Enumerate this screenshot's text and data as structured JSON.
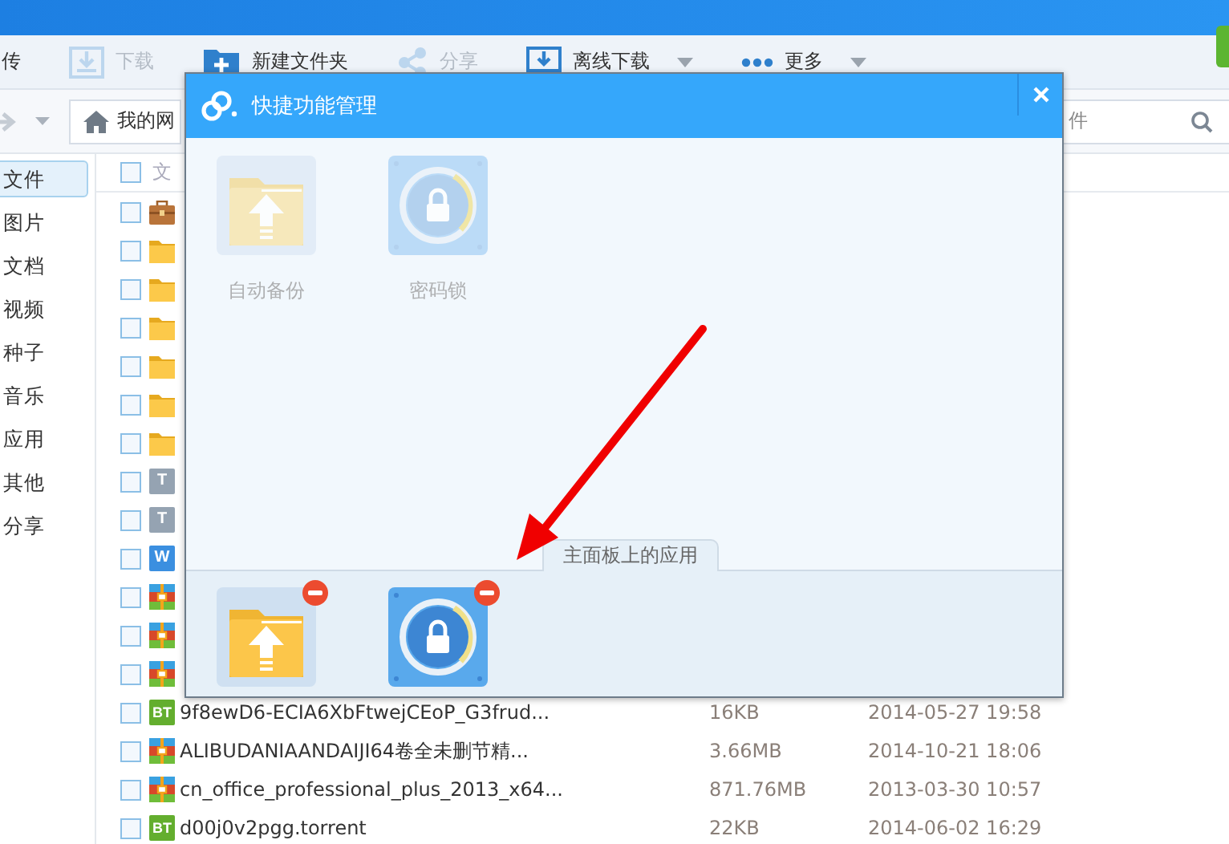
{
  "toolbar": {
    "items": [
      {
        "kind": "upload",
        "label": "传",
        "disabled": false,
        "has_menu": false
      },
      {
        "kind": "download",
        "label": "下载",
        "disabled": true,
        "has_menu": false
      },
      {
        "kind": "new-folder",
        "label": "新建文件夹",
        "disabled": false,
        "has_menu": false
      },
      {
        "kind": "share",
        "label": "分享",
        "disabled": true,
        "has_menu": false
      },
      {
        "kind": "offline",
        "label": "离线下载",
        "disabled": false,
        "has_menu": true
      },
      {
        "kind": "more",
        "label": "更多",
        "disabled": false,
        "has_menu": true
      }
    ]
  },
  "nav": {
    "location": "我的网",
    "search": {
      "placeholder": "件"
    }
  },
  "sidebar": {
    "items": [
      {
        "label": "文件",
        "selected": true
      },
      {
        "label": "图片",
        "selected": false
      },
      {
        "label": "文档",
        "selected": false
      },
      {
        "label": "视频",
        "selected": false
      },
      {
        "label": "种子",
        "selected": false
      },
      {
        "label": "音乐",
        "selected": false
      },
      {
        "label": "应用",
        "selected": false
      },
      {
        "label": "其他",
        "selected": false
      },
      {
        "label": "分享",
        "selected": false
      }
    ]
  },
  "file_list": {
    "header": {
      "label": "文",
      "checked": false
    },
    "rows": [
      {
        "kind": "briefcase",
        "checked": false
      },
      {
        "kind": "folder",
        "checked": false
      },
      {
        "kind": "folder",
        "checked": false
      },
      {
        "kind": "folder",
        "checked": false
      },
      {
        "kind": "folder",
        "checked": false
      },
      {
        "kind": "folder",
        "checked": false
      },
      {
        "kind": "folder",
        "checked": false
      },
      {
        "kind": "text",
        "badge": "T",
        "checked": false
      },
      {
        "kind": "text",
        "badge": "T",
        "checked": false
      },
      {
        "kind": "word",
        "badge": "W",
        "checked": false
      },
      {
        "kind": "archive",
        "checked": false
      },
      {
        "kind": "archive",
        "checked": false
      },
      {
        "kind": "archive",
        "checked": false
      },
      {
        "kind": "bt",
        "badge": "BT",
        "checked": false,
        "name": "9f8ewD6-ECIA6XbFtwejCEoP_G3frud...",
        "size": "16KB",
        "date": "2014-05-27 19:58"
      },
      {
        "kind": "archive",
        "checked": false,
        "name": "ALIBUDANIAANDAIJI64卷全未删节精...",
        "size": "3.66MB",
        "date": "2014-10-21 18:06"
      },
      {
        "kind": "archive",
        "checked": false,
        "name": "cn_office_professional_plus_2013_x64...",
        "size": "871.76MB",
        "date": "2013-03-30 10:57"
      },
      {
        "kind": "bt",
        "badge": "BT",
        "checked": false,
        "name": "d00j0v2pgg.torrent",
        "size": "22KB",
        "date": "2014-06-02 16:29"
      }
    ]
  },
  "dialog": {
    "title": "快捷功能管理",
    "available_apps": [
      {
        "kind": "backup",
        "label": "自动备份",
        "added": true
      },
      {
        "kind": "lock",
        "label": "密码锁",
        "added": true
      }
    ],
    "panel": {
      "title": "主面板上的应用",
      "apps": [
        {
          "kind": "backup"
        },
        {
          "kind": "lock"
        }
      ]
    }
  }
}
